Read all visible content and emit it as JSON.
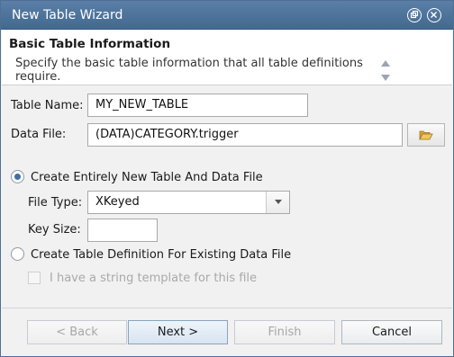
{
  "window": {
    "title": "New Table Wizard"
  },
  "header": {
    "title": "Basic Table Information",
    "description": "Specify the basic table information that all table definitions require."
  },
  "form": {
    "table_name_label": "Table Name:",
    "table_name_value": "MY_NEW_TABLE",
    "data_file_label": "Data File:",
    "data_file_value": "(DATA)CATEGORY.trigger",
    "option_new_label": "Create Entirely New Table And Data File",
    "option_new_selected": true,
    "file_type_label": "File Type:",
    "file_type_value": "XKeyed",
    "key_size_label": "Key Size:",
    "key_size_value": "",
    "option_existing_label": "Create Table Definition For Existing Data File",
    "option_existing_selected": false,
    "string_template_label": "I have a string template for this file",
    "string_template_checked": false
  },
  "buttons": {
    "back_label": "< Back",
    "next_label": "Next >",
    "finish_label": "Finish",
    "cancel_label": "Cancel"
  },
  "icons": {
    "restore": "restore-icon",
    "close": "close-icon",
    "browse": "folder-open-icon"
  },
  "colors": {
    "titlebar": "#4f759d",
    "accent": "#3e6fa3",
    "folder": "#e8b84a"
  }
}
